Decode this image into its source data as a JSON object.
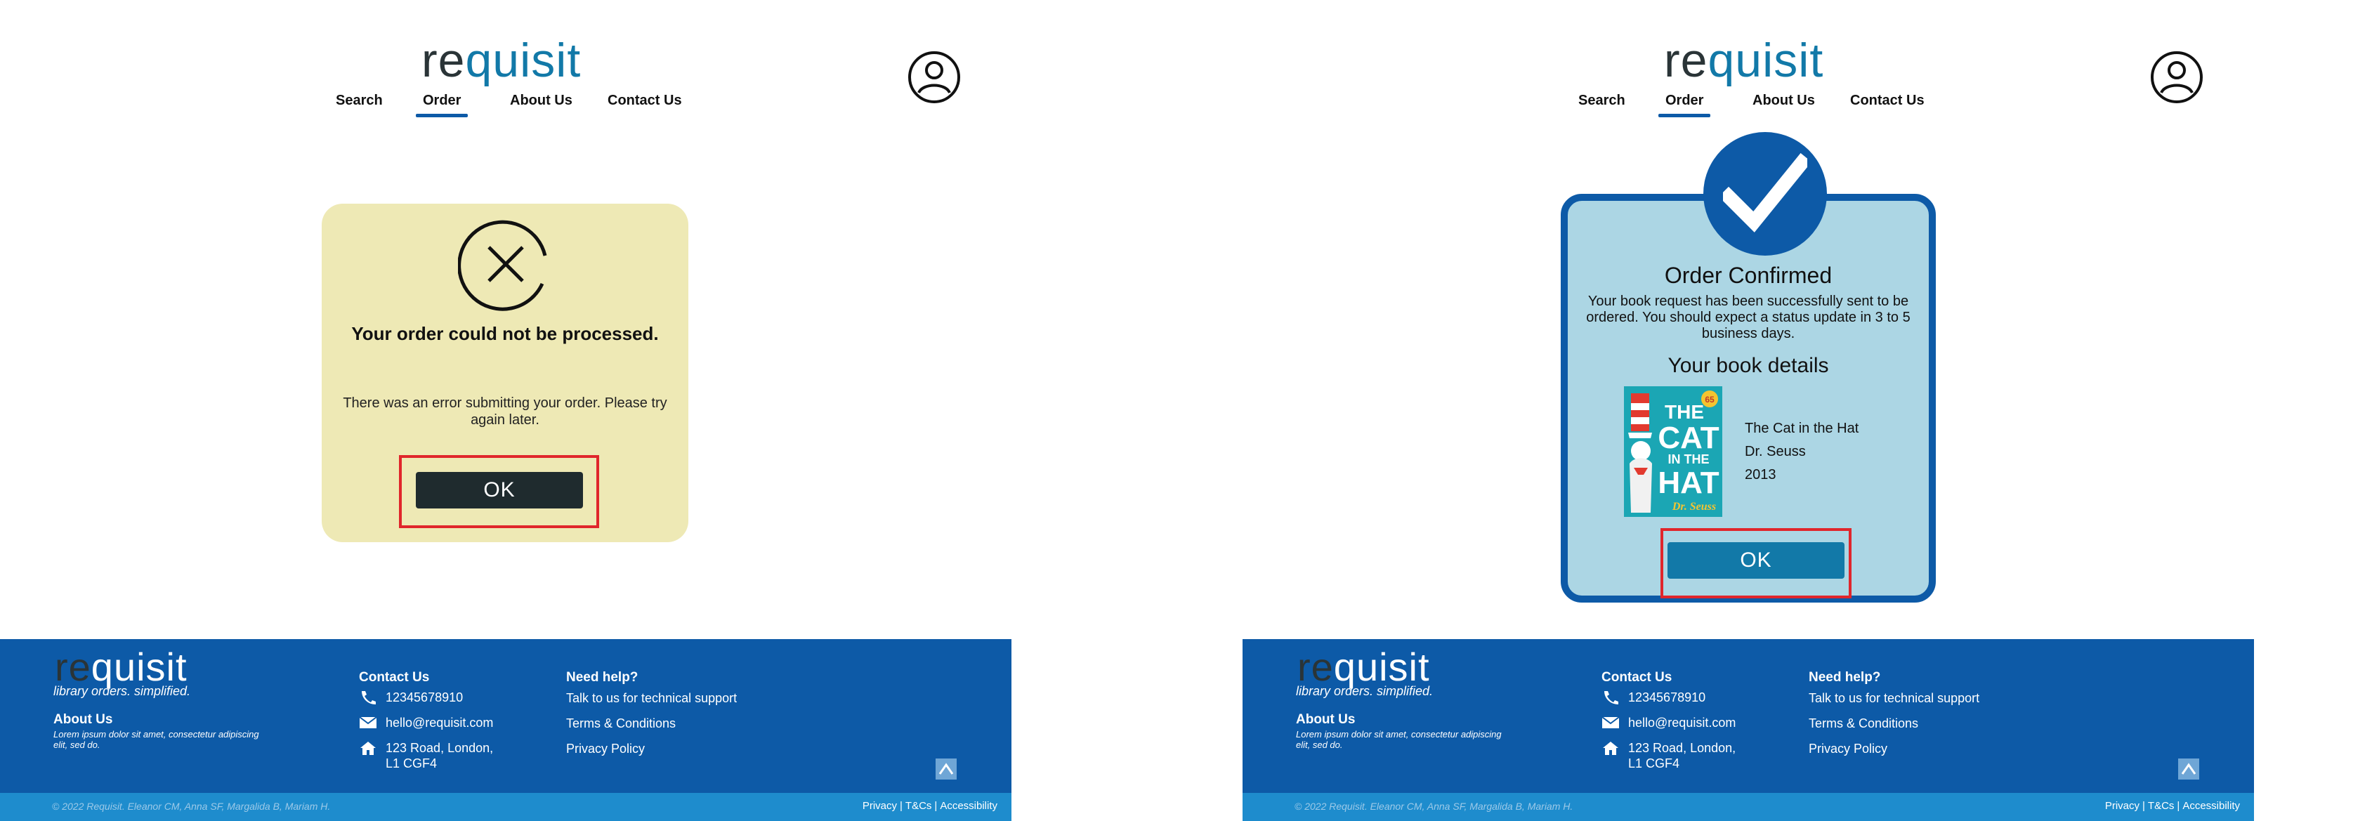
{
  "header": {
    "logo_re": "re",
    "logo_quisit": "quisit",
    "nav": {
      "search": "Search",
      "order": "Order",
      "about": "About Us",
      "contact": "Contact Us"
    },
    "active_nav": "Order"
  },
  "error_dialog": {
    "icon": "close-circle-icon",
    "title": "Your order could not be processed.",
    "message": "There was an error submitting your order. Please try again later.",
    "ok_label": "OK"
  },
  "confirm_dialog": {
    "icon": "check-icon",
    "title": "Order Confirmed",
    "message": "Your book  request has been successfully sent to be ordered. You should expect a status update in 3 to 5 business days.",
    "details_title": "Your book details",
    "book": {
      "title": "The Cat in the Hat",
      "author": "Dr. Seuss",
      "year": "2013",
      "cover_line1": "THE",
      "cover_line2": "CAT",
      "cover_line3": "IN THE",
      "cover_line4": "HAT",
      "cover_author": "Dr. Seuss",
      "cover_badge": "65"
    },
    "ok_label": "OK"
  },
  "footer": {
    "logo_re": "re",
    "logo_quisit": "quisit",
    "tagline": "library orders. simplified.",
    "about_heading": "About Us",
    "about_text": "Lorem ipsum dolor sit amet, consectetur adipiscing elit, sed do.",
    "contact_heading": "Contact Us",
    "phone": "12345678910",
    "email": "hello@requisit.com",
    "address_line1": "123 Road, London,",
    "address_line2": "L1 CGF4",
    "help_heading": "Need help?",
    "help_links": [
      "Talk to us for technical support",
      "Terms & Conditions",
      "Privacy Policy"
    ],
    "copyright": "© 2022 Requisit. Eleanor CM, Anna SF, Margalida B, Mariam H.",
    "legal": {
      "privacy": "Privacy",
      "tcs": "T&Cs",
      "accessibility": "Accessibility"
    }
  },
  "colors": {
    "brand_blue": "#0d5aa7",
    "teal": "#1279a8",
    "error_bg": "#eee9b5",
    "confirm_bg": "#acd6e4",
    "highlight_red": "#e0262b"
  }
}
